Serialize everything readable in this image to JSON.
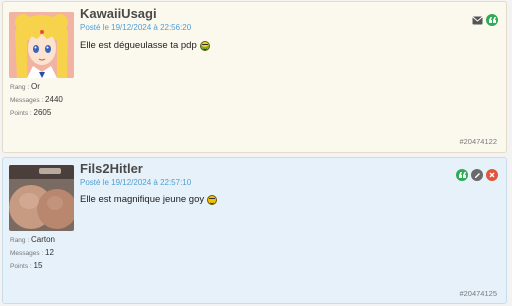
{
  "posts": [
    {
      "username": "KawaiiUsagi",
      "date": "Posté le 19/12/2024 à 22:56:20",
      "message": "Elle est dégueulasse ta pdp",
      "smiley": "smiley-icon",
      "meta": {
        "rank_label": "Rang",
        "rank_value": "Or",
        "messages_label": "Messages",
        "messages_value": "2440",
        "points_label": "Points",
        "points_value": "2605"
      },
      "post_id": "#20474122",
      "actions": [
        "mail-icon",
        "quote-icon"
      ]
    },
    {
      "username": "Fils2Hitler",
      "date": "Posté le 19/12/2024 à 22:57:10",
      "message": "Elle est magnifique jeune goy",
      "smiley": "smiley-icon",
      "meta": {
        "rank_label": "Rang",
        "rank_value": "Carton",
        "messages_label": "Messages",
        "messages_value": "12",
        "points_label": "Points",
        "points_value": "15"
      },
      "post_id": "#20474125",
      "actions": [
        "quote-icon",
        "edit-icon",
        "delete-icon"
      ]
    }
  ],
  "colors": {
    "post1_bg": "#fbf8ee",
    "post2_bg": "#e6f1fa",
    "date_link": "#4f9fd5",
    "quote_green": "#2faa55",
    "delete_red": "#e2553d",
    "edit_gray": "#6a6a6a"
  }
}
